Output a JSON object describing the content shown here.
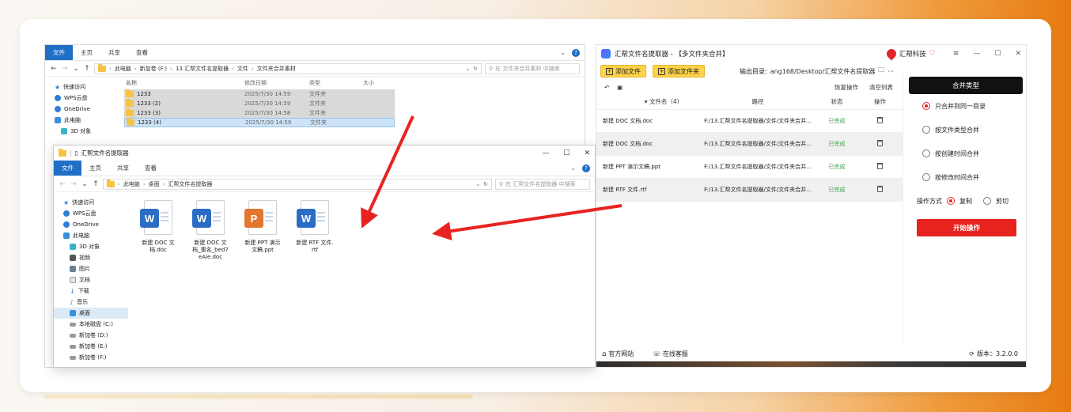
{
  "explorer1": {
    "ribbon_tabs": [
      "文件",
      "主页",
      "共享",
      "查看"
    ],
    "breadcrumb": [
      "此电脑",
      "新加卷 (F:)",
      "13.汇帮文件名提取器",
      "文件",
      "文件夹合并素材"
    ],
    "search_placeholder": "在 文件夹合并素材 中搜索",
    "nav": [
      {
        "label": "快速访问",
        "icon": "star-icon"
      },
      {
        "label": "WPS云盘",
        "icon": "cloud-icon"
      },
      {
        "label": "OneDrive",
        "icon": "onedrive-icon"
      },
      {
        "label": "此电脑",
        "icon": "pc-icon"
      },
      {
        "label": "3D 对象",
        "icon": "3d-icon"
      }
    ],
    "columns": [
      "名称",
      "修改日期",
      "类型",
      "大小"
    ],
    "rows": [
      {
        "name": "1233",
        "date": "2025/7/30 14:59",
        "type": "文件夹"
      },
      {
        "name": "1233 (2)",
        "date": "2025/7/30 14:59",
        "type": "文件夹"
      },
      {
        "name": "1233 (3)",
        "date": "2025/7/30 14:58",
        "type": "文件夹"
      },
      {
        "name": "1233 (4)",
        "date": "2025/7/30 14:59",
        "type": "文件夹"
      }
    ]
  },
  "explorer2": {
    "title": "汇帮文件名提取器",
    "ribbon_tabs": [
      "文件",
      "主页",
      "共享",
      "查看"
    ],
    "breadcrumb": [
      "此电脑",
      "桌面",
      "汇帮文件名提取器"
    ],
    "search_placeholder": "在 汇帮文件名提取器 中搜索",
    "nav": [
      {
        "label": "快速访问"
      },
      {
        "label": "WPS云盘"
      },
      {
        "label": "OneDrive"
      },
      {
        "label": "此电脑"
      },
      {
        "label": "3D 对象"
      },
      {
        "label": "视频"
      },
      {
        "label": "图片"
      },
      {
        "label": "文档"
      },
      {
        "label": "下载"
      },
      {
        "label": "音乐"
      },
      {
        "label": "桌面"
      },
      {
        "label": "本地磁盘 (C:)"
      },
      {
        "label": "新加卷 (D:)"
      },
      {
        "label": "新加卷 (E:)"
      },
      {
        "label": "新加卷 (F:)"
      }
    ],
    "files": [
      {
        "badge": "W",
        "name": "新建 DOC 文档.doc"
      },
      {
        "badge": "W",
        "name": "新建 DOC 文档_重名_bed7eAie.doc"
      },
      {
        "badge": "P",
        "name": "新建 PPT 演示文稿.ppt"
      },
      {
        "badge": "W",
        "name": "新建 RTF 文件.rtf"
      }
    ]
  },
  "app": {
    "title": "汇帮文件名提取器 - 【多文件夹合并】",
    "brand": "汇帮科技",
    "add_file": "添加文件",
    "add_folder": "添加文件夹",
    "output_label": "输出目录:",
    "output_path": "ang168/Desktop/汇帮文件名提取器",
    "restore": "恢复操作",
    "clear": "清空列表",
    "columns": {
      "name": "文件名（4）",
      "path": "路径",
      "status": "状态",
      "op": "操作"
    },
    "rows": [
      {
        "name": "新建 DOC 文档.doc",
        "path": "F:/13.汇帮文件名提取器/文件/文件夹合并...",
        "status": "已完成"
      },
      {
        "name": "新建 DOC 文档.doc",
        "path": "F:/13.汇帮文件名提取器/文件/文件夹合并...",
        "status": "已完成"
      },
      {
        "name": "新建 PPT 演示文稿.ppt",
        "path": "F:/13.汇帮文件名提取器/文件/文件夹合并...",
        "status": "已完成"
      },
      {
        "name": "新建 RTF 文件.rtf",
        "path": "F:/13.汇帮文件名提取器/文件/文件夹合并...",
        "status": "已完成"
      }
    ],
    "merge_type_title": "合并类型",
    "merge_options": [
      {
        "label": "只合并到同一目录",
        "selected": true
      },
      {
        "label": "按文件类型合并",
        "selected": false
      },
      {
        "label": "按创建时间合并",
        "selected": false
      },
      {
        "label": "按修改时间合并",
        "selected": false
      }
    ],
    "op_mode_label": "操作方式",
    "op_copy": "复制",
    "op_cut": "剪切",
    "start": "开始操作",
    "official_site": "官方网站",
    "online_service": "在线客服",
    "version": "版本：3.2.0.0"
  },
  "colors": {
    "accent_red": "#e8231f",
    "button_yellow": "#ffd24a",
    "status_green": "#3aa14a",
    "win_blue": "#1f6fc5"
  }
}
